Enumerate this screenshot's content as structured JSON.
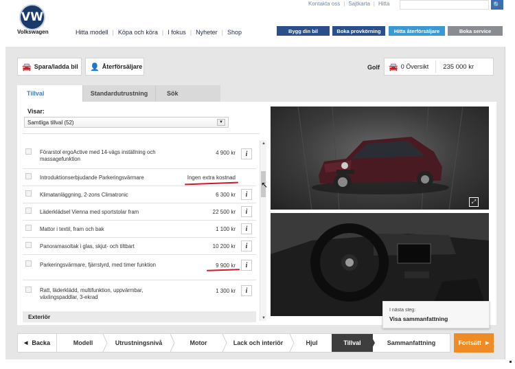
{
  "header": {
    "brand": "Volkswagen",
    "logo_letters": "VW",
    "nav": [
      "Hitta modell",
      "Köpa och köra",
      "I fokus",
      "Nyheter",
      "Shop"
    ],
    "top_links": [
      "Kontakta oss",
      "Sajtkarta",
      "Hitta"
    ],
    "search_placeholder": "",
    "buttons": [
      "Bygg din bil",
      "Boka provkörning",
      "Hitta återförsäljare",
      "Boka service"
    ]
  },
  "toolbar": {
    "save_label": "Spara/ladda bil",
    "dealer_label": "Återförsäljare",
    "model": "Golf",
    "overview_label": "0 Översikt",
    "price": "235 000 kr"
  },
  "tabs": [
    "Tillval",
    "Standardutrustning",
    "Sök"
  ],
  "filter": {
    "label": "Visar:",
    "selected": "Samtliga tillval (52)"
  },
  "options": [
    {
      "name": "Förarstol ergoActive med 14-vägs inställning och massagefunktion",
      "price": "4 900 kr",
      "info": "i"
    },
    {
      "name": "Introduktionserbjudande Parkeringsvärmare",
      "price": "Ingen extra kostnad",
      "info": ""
    },
    {
      "name": "Klimatanläggning, 2-zons Climatronic",
      "price": "6 300 kr",
      "info": "i"
    },
    {
      "name": "Läderklädsel Vienna med sportstolar fram",
      "price": "22 500 kr",
      "info": "i"
    },
    {
      "name": "Mattor i textil, fram och bak",
      "price": "1 100 kr",
      "info": "i"
    },
    {
      "name": "Panoramasoltak i glas, skjut- och tiltbart",
      "price": "10 200 kr",
      "info": "i"
    },
    {
      "name": "Parkeringsvärmare, fjärrstyrd, med timer funktion",
      "price": "9 900 kr",
      "info": "i"
    },
    {
      "name": "Ratt, läderklädd, multifunktion, uppvärmbar, växlingspaddlar, 3-ekrad",
      "price": "1 300 kr",
      "info": "i"
    }
  ],
  "section_label": "Exteriör",
  "next_step": {
    "label": "I nästa steg:",
    "value": "Visa sammanfattning"
  },
  "steps": {
    "back": "Backa",
    "items": [
      "Modell",
      "Utrustningsnivå",
      "Motor",
      "Lack och interiör",
      "Hjul",
      "Tillval",
      "Sammanfattning"
    ],
    "active": "Tillval",
    "next": "Fortsätt"
  },
  "colors": {
    "accent_blue": "#2a4f8b",
    "accent_cyan": "#3a98d4",
    "next_orange": "#f08a24",
    "highlight_red": "#d0162b"
  }
}
